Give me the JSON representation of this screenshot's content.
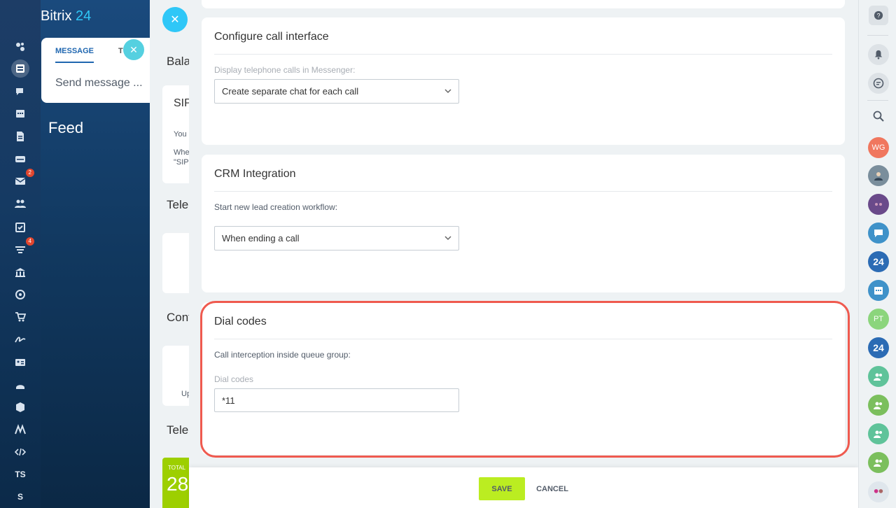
{
  "app": {
    "logo_text": "Bitrix",
    "logo_num": "24",
    "compose": {
      "tab_message": "MESSAGE",
      "tab_second_partial": "T",
      "placeholder": "Send message ..."
    },
    "feed_title": "Feed",
    "left_badges": {
      "mail": "2",
      "crm": "4"
    },
    "left_text_items": [
      "TS",
      "S"
    ]
  },
  "mid_panel": {
    "title_partial": "Bala",
    "card_title_partial": "SIP",
    "card_text_1": "You",
    "card_text_2": "Whe",
    "card_text_3": "\"SIP",
    "section2_partial": "Telep",
    "section3_partial": "Confi",
    "card_text_up": "Up",
    "section4_partial": "Telep",
    "total_label": "TOTAL",
    "total_value": "28"
  },
  "sections": {
    "call_interface": {
      "title": "Configure call interface",
      "label": "Display telephone calls in Messenger:",
      "select_value": "Create separate chat for each call"
    },
    "crm": {
      "title": "CRM Integration",
      "label": "Start new lead creation workflow:",
      "select_value": "When ending a call"
    },
    "dial_codes": {
      "title": "Dial codes",
      "label": "Call interception inside queue group:",
      "field_label": "Dial codes",
      "field_value": "*11"
    }
  },
  "footer": {
    "save_label": "SAVE",
    "cancel_label": "CANCEL"
  },
  "right_bar": {
    "avatars": [
      {
        "name": "wg-avatar",
        "initials": "WG",
        "color": "#f0775e"
      },
      {
        "name": "pt-avatar",
        "initials": "PT",
        "color": "#8bd57c"
      }
    ],
    "badge_24": "24"
  },
  "colors": {
    "accent": "#2fc7f7",
    "save": "#bbed21",
    "highlight": "#ef5a4f"
  }
}
